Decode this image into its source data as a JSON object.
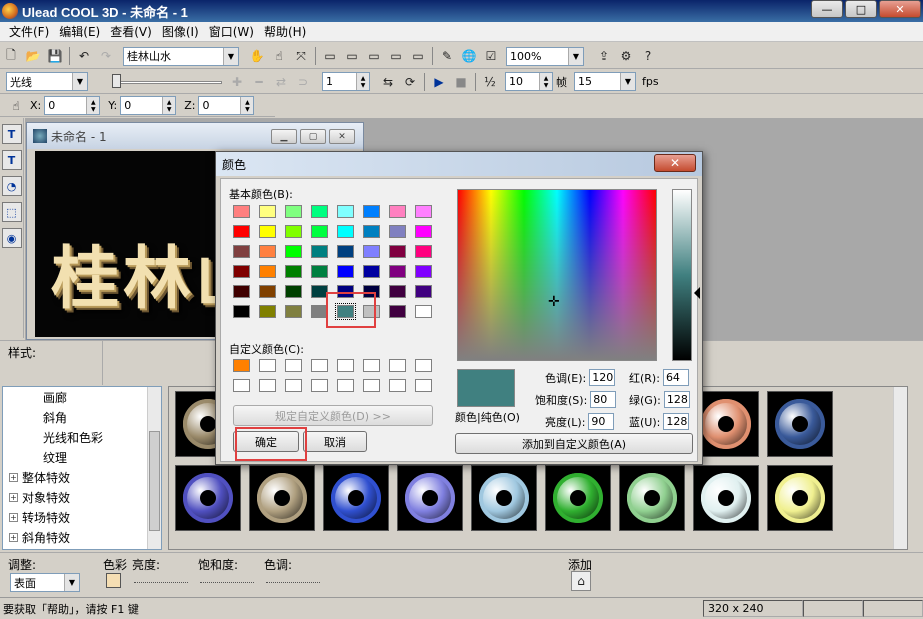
{
  "app": {
    "title": "Ulead COOL 3D - 未命名 - 1"
  },
  "window_buttons": {
    "minimize": "—",
    "maximize": "□",
    "close": "✕"
  },
  "menu": [
    "文件(F)",
    "编辑(E)",
    "查看(V)",
    "图像(I)",
    "窗口(W)",
    "帮助(H)"
  ],
  "toolbar1": {
    "object_combo": "桂林山水",
    "zoom_combo": "100%"
  },
  "toolbar2": {
    "attribute_combo": "光线",
    "frame_value": "1",
    "frames_total": "10",
    "frames_label": "帧",
    "fps_value": "15",
    "fps_label": "fps"
  },
  "toolbar3": {
    "x_label": "X:",
    "x_value": "0",
    "y_label": "Y:",
    "y_value": "0",
    "z_label": "Z:",
    "z_value": "0"
  },
  "document": {
    "title": "未命名 - 1",
    "canvas_text": "桂林山"
  },
  "style_panel": {
    "label": "样式:"
  },
  "tree": [
    {
      "label": "画廊",
      "indent": 2
    },
    {
      "label": "斜角",
      "indent": 2
    },
    {
      "label": "光线和色彩",
      "indent": 2
    },
    {
      "label": "纹理",
      "indent": 2
    },
    {
      "label": "整体特效",
      "indent": 0,
      "expand": "+"
    },
    {
      "label": "对象特效",
      "indent": 0,
      "expand": "+"
    },
    {
      "label": "转场特效",
      "indent": 0,
      "expand": "+"
    },
    {
      "label": "斜角特效",
      "indent": 0,
      "expand": "+"
    }
  ],
  "thumbnails": [
    [
      "#9a8a6a",
      "#4a6a8a",
      "#c08060",
      "#70a0c8",
      "#808080",
      "#b06040",
      "#c06040",
      "#e09070",
      "#3a5a9a"
    ],
    [
      "#5050c0",
      "#b0a080",
      "#3050d0",
      "#8080e0",
      "#a0c8e0",
      "#30b030",
      "#90d090",
      "#e0f0f0",
      "#f0f090"
    ]
  ],
  "adjust": {
    "label": "调整:",
    "mode_combo": "表面",
    "color_label": "色彩",
    "brightness_label": "亮度:",
    "saturation_label": "饱和度:",
    "hue_label": "色调:",
    "add_label": "添加"
  },
  "status": {
    "message": "要获取「帮助」，请按 F1 键",
    "size": "320 x 240"
  },
  "color_dialog": {
    "title": "颜色",
    "close": "✕",
    "basic_label": "基本颜色(B):",
    "basic_colors": [
      "#ff8080",
      "#ffff80",
      "#80ff80",
      "#00ff80",
      "#80ffff",
      "#0080ff",
      "#ff80c0",
      "#ff80ff",
      "#ff0000",
      "#ffff00",
      "#80ff00",
      "#00ff40",
      "#00ffff",
      "#0080c0",
      "#8080c0",
      "#ff00ff",
      "#804040",
      "#ff8040",
      "#00ff00",
      "#008080",
      "#004080",
      "#8080ff",
      "#800040",
      "#ff0080",
      "#800000",
      "#ff8000",
      "#008000",
      "#008040",
      "#0000ff",
      "#0000a0",
      "#800080",
      "#8000ff",
      "#400000",
      "#804000",
      "#004000",
      "#004040",
      "#000080",
      "#000040",
      "#400040",
      "#400080",
      "#000000",
      "#808000",
      "#808040",
      "#808080",
      "#408080",
      "#c0c0c0",
      "#400040",
      "#ffffff"
    ],
    "custom_label": "自定义颜色(C):",
    "custom_colors": [
      "#ff8000",
      "#ffffff",
      "#ffffff",
      "#ffffff",
      "#ffffff",
      "#ffffff",
      "#ffffff",
      "#ffffff",
      "#ffffff",
      "#ffffff",
      "#ffffff",
      "#ffffff",
      "#ffffff",
      "#ffffff",
      "#ffffff",
      "#ffffff"
    ],
    "define_custom": "规定自定义颜色(D) >>",
    "ok": "确定",
    "cancel": "取消",
    "color_solid_label": "颜色|纯色(O)",
    "hue_label": "色调(E):",
    "hue": "120",
    "sat_label": "饱和度(S):",
    "sat": "80",
    "lum_label": "亮度(L):",
    "lum": "90",
    "red_label": "红(R):",
    "red": "64",
    "green_label": "绿(G):",
    "green": "128",
    "blue_label": "蓝(U):",
    "blue": "128",
    "add_custom": "添加到自定义颜色(A)",
    "selected_color": "#408080"
  }
}
